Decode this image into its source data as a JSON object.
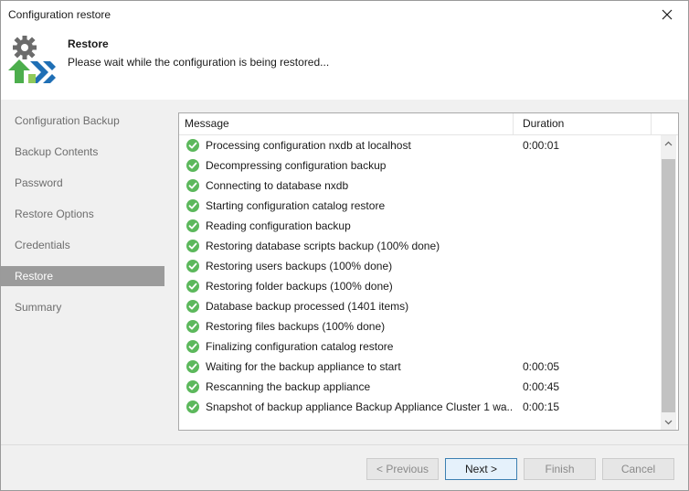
{
  "window": {
    "title": "Configuration restore"
  },
  "header": {
    "title": "Restore",
    "subtitle": "Please wait while the configuration is being restored..."
  },
  "sidebar": {
    "items": [
      {
        "label": "Configuration Backup",
        "active": false
      },
      {
        "label": "Backup Contents",
        "active": false
      },
      {
        "label": "Password",
        "active": false
      },
      {
        "label": "Restore Options",
        "active": false
      },
      {
        "label": "Credentials",
        "active": false
      },
      {
        "label": "Restore",
        "active": true
      },
      {
        "label": "Summary",
        "active": false
      }
    ]
  },
  "log": {
    "columns": {
      "message": "Message",
      "duration": "Duration"
    },
    "rows": [
      {
        "message": "Processing configuration nxdb at localhost",
        "duration": "0:00:01",
        "status": "success"
      },
      {
        "message": "Decompressing configuration backup",
        "duration": "",
        "status": "success"
      },
      {
        "message": "Connecting to database nxdb",
        "duration": "",
        "status": "success"
      },
      {
        "message": "Starting configuration catalog restore",
        "duration": "",
        "status": "success"
      },
      {
        "message": "Reading configuration backup",
        "duration": "",
        "status": "success"
      },
      {
        "message": "Restoring database scripts backup (100% done)",
        "duration": "",
        "status": "success"
      },
      {
        "message": "Restoring users backups (100% done)",
        "duration": "",
        "status": "success"
      },
      {
        "message": "Restoring folder backups (100% done)",
        "duration": "",
        "status": "success"
      },
      {
        "message": "Database backup processed (1401 items)",
        "duration": "",
        "status": "success"
      },
      {
        "message": "Restoring files backups (100% done)",
        "duration": "",
        "status": "success"
      },
      {
        "message": "Finalizing configuration catalog restore",
        "duration": "",
        "status": "success"
      },
      {
        "message": "Waiting for the backup appliance to start",
        "duration": "0:00:05",
        "status": "success"
      },
      {
        "message": "Rescanning the backup appliance",
        "duration": "0:00:45",
        "status": "success"
      },
      {
        "message": "Snapshot of backup appliance Backup Appliance Cluster 1 wa...",
        "duration": "0:00:15",
        "status": "success"
      }
    ]
  },
  "buttons": {
    "previous": "< Previous",
    "next": "Next >",
    "finish": "Finish",
    "cancel": "Cancel"
  },
  "colors": {
    "success": "#5cb85c",
    "active_nav": "#9b9b9b",
    "panel_bg": "#f0f0f0"
  },
  "icons": {
    "close": "close-icon",
    "logo": "config-restore-logo-icon",
    "row_status": "success-check-icon",
    "scroll_up": "scroll-up-arrow-icon",
    "scroll_down": "scroll-down-arrow-icon"
  }
}
